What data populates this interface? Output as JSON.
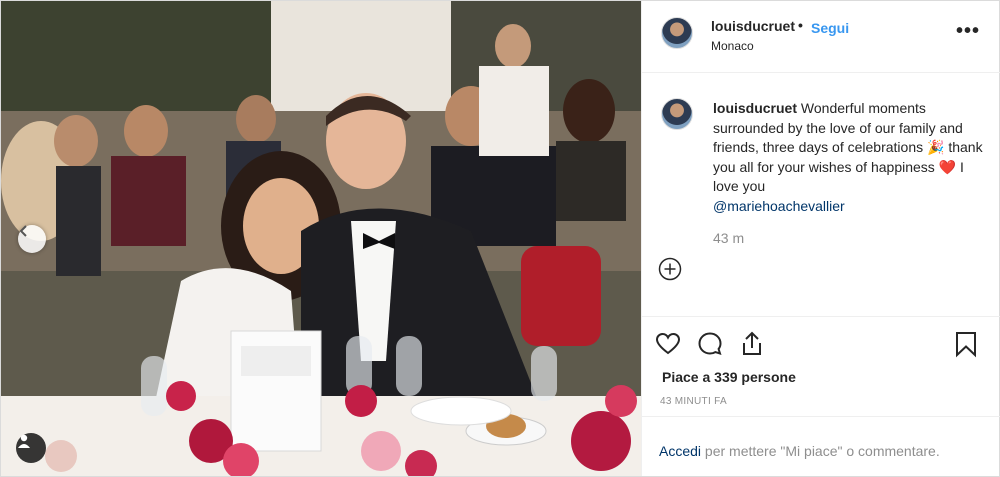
{
  "post": {
    "username": "louisducruet",
    "dot": "•",
    "follow_label": "Segui",
    "location": "Monaco",
    "more_label": "•••"
  },
  "caption": {
    "username": "louisducruet",
    "text_1": "Wonderful moments surrounded by the love of our family and friends, three days of celebrations",
    "party_emoji": "🎉",
    "text_2": "thank you all for your wishes of happiness",
    "heart_emoji": "❤️",
    "text_3": "I love you",
    "mention": "@mariehoachevallier",
    "time": "43 m"
  },
  "engagement": {
    "likes": "Piace a 339 persone",
    "posted_ago": "43 MINUTI FA"
  },
  "login_prompt": {
    "link": "Accedi",
    "text": "per mettere \"Mi piace\" o commentare."
  },
  "icons": {
    "like": "heart-icon",
    "comment": "comment-icon",
    "share": "share-icon",
    "save": "bookmark-icon",
    "add_comment": "plus-circle-icon",
    "prev": "chevron-left-icon",
    "tags": "user-tag-icon"
  },
  "colors": {
    "link_blue": "#3897f0",
    "mention_blue": "#003569",
    "muted": "#8e8e8e",
    "text": "#262626"
  }
}
